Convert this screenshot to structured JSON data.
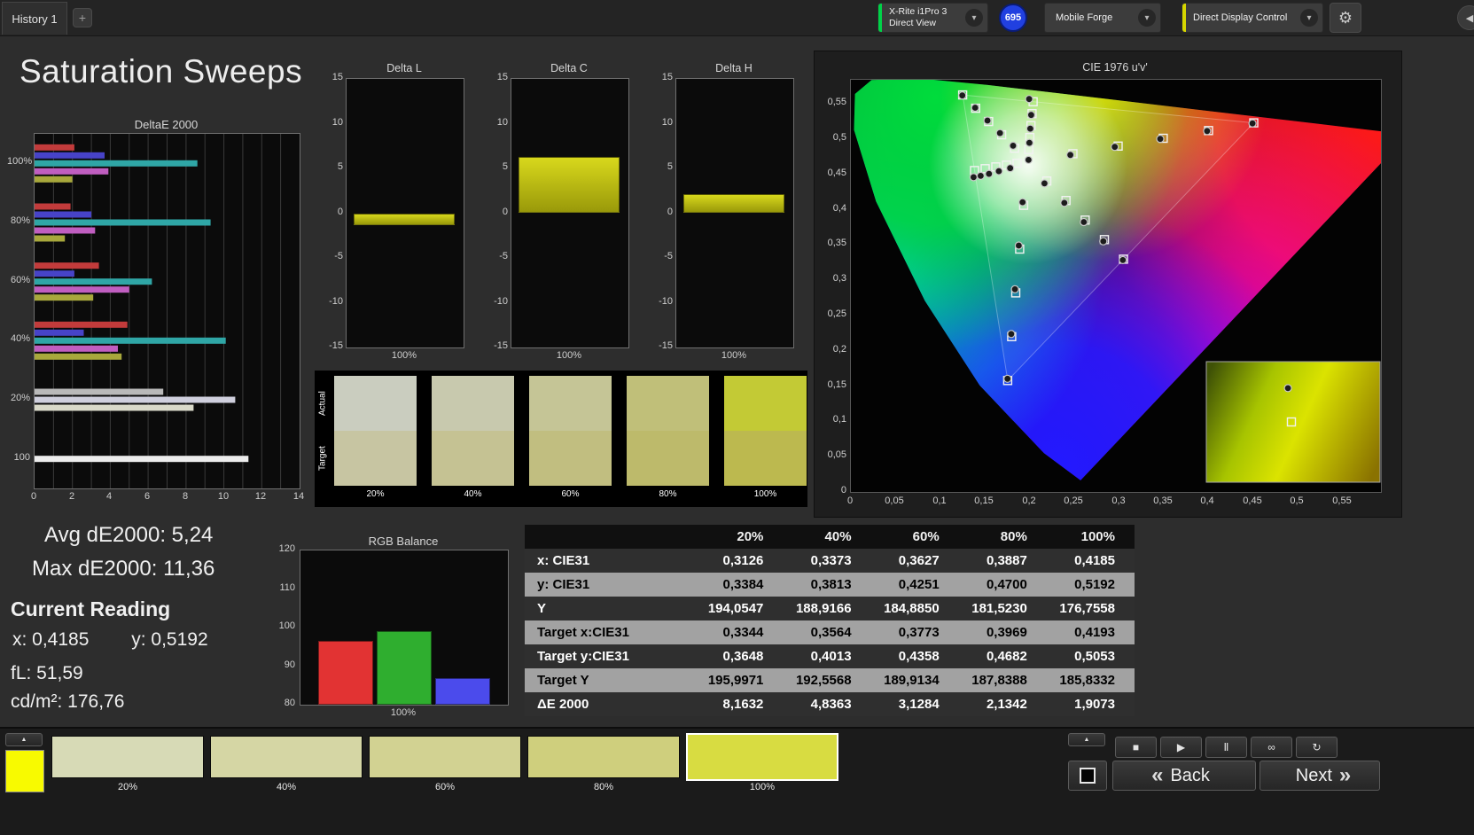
{
  "top_bar": {
    "history_tab": "History 1",
    "add_tab": "+",
    "meter": {
      "line1": "X-Rite i1Pro 3",
      "line2": "Direct View",
      "accent": "#00d248"
    },
    "badge": "695",
    "source": {
      "label": "Mobile Forge"
    },
    "display_control": {
      "label": "Direct Display Control",
      "accent": "#d6d600"
    }
  },
  "page": {
    "title": "Saturation Sweeps"
  },
  "stats": {
    "avg": "Avg dE2000: 5,24",
    "max": "Max dE2000: 11,36",
    "current_reading_label": "Current Reading",
    "x": "x: 0,4185",
    "y": "y: 0,5192",
    "fl": "fL: 51,59",
    "cdm2": "cd/m²: 176,76"
  },
  "swatch_panel": {
    "row_labels": [
      "Actual",
      "Target"
    ],
    "columns": [
      {
        "label": "20%",
        "actual": "#cacdbf",
        "target": "#c7c5a2"
      },
      {
        "label": "40%",
        "actual": "#c8c9ae",
        "target": "#c5c293"
      },
      {
        "label": "60%",
        "actual": "#c5c596",
        "target": "#c1be80"
      },
      {
        "label": "80%",
        "actual": "#c0bf79",
        "target": "#bdba6b"
      },
      {
        "label": "100%",
        "actual": "#c3ca35",
        "target": "#bcb94f"
      }
    ]
  },
  "chart_data": [
    {
      "id": "deltaE2000",
      "type": "bar",
      "orientation": "horizontal",
      "title": "DeltaE 2000",
      "xlim": [
        0,
        14
      ],
      "x_ticks": [
        0,
        2,
        4,
        6,
        8,
        10,
        12,
        14
      ],
      "grid_step": 1,
      "groups": [
        {
          "label": "100%",
          "bars": [
            {
              "color": "#c23b3b",
              "value": 2.1
            },
            {
              "color": "#4743c8",
              "value": 3.7
            },
            {
              "color": "#2fa6a6",
              "value": 8.6
            },
            {
              "color": "#c05ec0",
              "value": 3.9
            },
            {
              "color": "#a8a83c",
              "value": 2.0
            }
          ]
        },
        {
          "label": "80%",
          "bars": [
            {
              "color": "#c23b3b",
              "value": 1.9
            },
            {
              "color": "#4743c8",
              "value": 3.0
            },
            {
              "color": "#2fa6a6",
              "value": 9.3
            },
            {
              "color": "#c05ec0",
              "value": 3.2
            },
            {
              "color": "#a8a83c",
              "value": 1.6
            }
          ]
        },
        {
          "label": "60%",
          "bars": [
            {
              "color": "#c23b3b",
              "value": 3.4
            },
            {
              "color": "#4743c8",
              "value": 2.1
            },
            {
              "color": "#2fa6a6",
              "value": 6.2
            },
            {
              "color": "#c05ec0",
              "value": 5.0
            },
            {
              "color": "#a8a83c",
              "value": 3.1
            }
          ]
        },
        {
          "label": "40%",
          "bars": [
            {
              "color": "#c23b3b",
              "value": 4.9
            },
            {
              "color": "#4743c8",
              "value": 2.6
            },
            {
              "color": "#2fa6a6",
              "value": 10.1
            },
            {
              "color": "#c05ec0",
              "value": 4.4
            },
            {
              "color": "#a8a83c",
              "value": 4.6
            }
          ]
        },
        {
          "label": "20%",
          "bars": [
            {
              "color": "#b9b9b9",
              "value": 6.8
            },
            {
              "color": "#cfcfdd",
              "value": 10.6
            },
            {
              "color": "#d9d9c9",
              "value": 8.4
            }
          ]
        },
        {
          "label": "100",
          "bars": [
            {
              "color": "#ececec",
              "value": 11.3
            }
          ]
        }
      ]
    },
    {
      "id": "delta_l",
      "type": "bar",
      "title": "Delta L",
      "categories": [
        "100%"
      ],
      "values": [
        -1.3
      ],
      "ylim": [
        -15,
        15
      ],
      "y_ticks": [
        15,
        10,
        5,
        0,
        -5,
        -10,
        -15
      ],
      "bar_top": "#d8d81c",
      "bar_bottom": "#99990a"
    },
    {
      "id": "delta_c",
      "type": "bar",
      "title": "Delta C",
      "categories": [
        "100%"
      ],
      "values": [
        6.3
      ],
      "ylim": [
        -15,
        15
      ],
      "y_ticks": [
        15,
        10,
        5,
        0,
        -5,
        -10,
        -15
      ],
      "bar_top": "#d8d81c",
      "bar_bottom": "#99990a"
    },
    {
      "id": "delta_h",
      "type": "bar",
      "title": "Delta H",
      "categories": [
        "100%"
      ],
      "values": [
        2.1
      ],
      "ylim": [
        -15,
        15
      ],
      "y_ticks": [
        15,
        10,
        5,
        0,
        -5,
        -10,
        -15
      ],
      "bar_top": "#d8d81c",
      "bar_bottom": "#99990a"
    },
    {
      "id": "cie1976",
      "type": "scatter",
      "title": "CIE 1976 u'v'",
      "xlim": [
        0,
        0.593
      ],
      "ylim": [
        0,
        0.584
      ],
      "ticks": [
        0,
        0.05,
        0.1,
        0.15,
        0.2,
        0.25,
        0.3,
        0.35,
        0.4,
        0.45,
        0.5,
        0.55
      ],
      "spectral_locus": [
        [
          0.2569,
          0.0165
        ],
        [
          0.2161,
          0.0549
        ],
        [
          0.1441,
          0.151
        ],
        [
          0.0828,
          0.2708
        ],
        [
          0.0282,
          0.4117
        ],
        [
          0.0035,
          0.5131
        ],
        [
          0.0046,
          0.5639
        ],
        [
          0.0231,
          0.5837
        ],
        [
          0.0792,
          0.5856
        ],
        [
          0.1531,
          0.5766
        ],
        [
          0.2623,
          0.5604
        ],
        [
          0.4035,
          0.5393
        ],
        [
          0.5202,
          0.5219
        ],
        [
          0.6005,
          0.5099
        ],
        [
          0.6234,
          0.5065
        ]
      ],
      "srgb_triangle": [
        [
          0.4507,
          0.5229
        ],
        [
          0.125,
          0.5625
        ],
        [
          0.1754,
          0.1579
        ]
      ],
      "targets": [
        [
          0.2484,
          0.4792
        ],
        [
          0.299,
          0.4901
        ],
        [
          0.3495,
          0.5011
        ],
        [
          0.4001,
          0.512
        ],
        [
          0.4507,
          0.5229
        ],
        [
          0.1832,
          0.4871
        ],
        [
          0.1687,
          0.506
        ],
        [
          0.1541,
          0.5248
        ],
        [
          0.1396,
          0.5437
        ],
        [
          0.125,
          0.5625
        ],
        [
          0.1933,
          0.4062
        ],
        [
          0.1888,
          0.3441
        ],
        [
          0.1844,
          0.2821
        ],
        [
          0.1799,
          0.22
        ],
        [
          0.1754,
          0.1579
        ],
        [
          0.1859,
          0.4657
        ],
        [
          0.174,
          0.4631
        ],
        [
          0.1621,
          0.4606
        ],
        [
          0.1502,
          0.458
        ],
        [
          0.1383,
          0.4554
        ],
        [
          0.2192,
          0.4406
        ],
        [
          0.2407,
          0.4129
        ],
        [
          0.2621,
          0.3852
        ],
        [
          0.2836,
          0.3575
        ],
        [
          0.305,
          0.3298
        ],
        [
          0.199,
          0.4852
        ],
        [
          0.2002,
          0.5021
        ],
        [
          0.2015,
          0.5191
        ],
        [
          0.2027,
          0.536
        ],
        [
          0.2039,
          0.5529
        ]
      ],
      "measured": [
        [
          0.2455,
          0.4775
        ],
        [
          0.2952,
          0.4889
        ],
        [
          0.3461,
          0.5002
        ],
        [
          0.3985,
          0.5114
        ],
        [
          0.4493,
          0.5222
        ],
        [
          0.1815,
          0.4905
        ],
        [
          0.1668,
          0.5085
        ],
        [
          0.1528,
          0.5262
        ],
        [
          0.139,
          0.5445
        ],
        [
          0.1246,
          0.5618
        ],
        [
          0.1921,
          0.4105
        ],
        [
          0.1878,
          0.3492
        ],
        [
          0.1836,
          0.2872
        ],
        [
          0.1794,
          0.2238
        ],
        [
          0.1752,
          0.1604
        ],
        [
          0.1782,
          0.4588
        ],
        [
          0.1655,
          0.4545
        ],
        [
          0.1545,
          0.4508
        ],
        [
          0.1452,
          0.4478
        ],
        [
          0.1372,
          0.446
        ],
        [
          0.2166,
          0.4372
        ],
        [
          0.2388,
          0.4096
        ],
        [
          0.2606,
          0.3824
        ],
        [
          0.2824,
          0.3552
        ],
        [
          0.3042,
          0.3285
        ],
        [
          0.1987,
          0.4705
        ],
        [
          0.1997,
          0.4947
        ],
        [
          0.2007,
          0.5148
        ],
        [
          0.2017,
          0.5342
        ],
        [
          0.1994,
          0.5567
        ]
      ],
      "inset": {
        "circle": [
          0.47,
          0.22
        ],
        "square": [
          0.49,
          0.5
        ]
      }
    },
    {
      "id": "rgb_balance",
      "type": "bar",
      "title": "RGB Balance",
      "categories": [
        "Red",
        "Green",
        "Blue"
      ],
      "values": [
        96.5,
        99,
        87
      ],
      "colors": [
        "#e23333",
        "#2fae2f",
        "#4b4bec"
      ],
      "ylim": [
        80,
        120
      ],
      "y_ticks": [
        120,
        110,
        100,
        90,
        80
      ],
      "xlabel": "100%"
    },
    {
      "id": "measurements",
      "type": "table",
      "columns": [
        "",
        "20%",
        "40%",
        "60%",
        "80%",
        "100%"
      ],
      "rows": [
        {
          "label": "x: CIE31",
          "values": [
            "0,3126",
            "0,3373",
            "0,3627",
            "0,3887",
            "0,4185"
          ]
        },
        {
          "label": "y: CIE31",
          "values": [
            "0,3384",
            "0,3813",
            "0,4251",
            "0,4700",
            "0,5192"
          ]
        },
        {
          "label": "Y",
          "values": [
            "194,0547",
            "188,9166",
            "184,8850",
            "181,5230",
            "176,7558"
          ]
        },
        {
          "label": "Target x:CIE31",
          "values": [
            "0,3344",
            "0,3564",
            "0,3773",
            "0,3969",
            "0,4193"
          ]
        },
        {
          "label": "Target y:CIE31",
          "values": [
            "0,3648",
            "0,4013",
            "0,4358",
            "0,4682",
            "0,5053"
          ]
        },
        {
          "label": "Target Y",
          "values": [
            "195,9971",
            "192,5568",
            "189,9134",
            "187,8388",
            "185,8332"
          ]
        },
        {
          "label": "ΔE 2000",
          "values": [
            "8,1632",
            "4,8363",
            "3,1284",
            "2,1342",
            "1,9073"
          ]
        }
      ]
    }
  ],
  "bottom_bar": {
    "corner_color": "#f8fa00",
    "swatches": [
      {
        "label": "20%",
        "color": "#d7dab6",
        "selected": false
      },
      {
        "label": "40%",
        "color": "#d5d6a4",
        "selected": false
      },
      {
        "label": "60%",
        "color": "#d2d292",
        "selected": false
      },
      {
        "label": "80%",
        "color": "#cfcf7d",
        "selected": false
      },
      {
        "label": "100%",
        "color": "#d8dc41",
        "selected": true
      }
    ],
    "transport": [
      {
        "name": "stop-icon",
        "glyph": "■"
      },
      {
        "name": "play-icon",
        "glyph": "▶"
      },
      {
        "name": "pause-icon",
        "glyph": "Ⅱ"
      },
      {
        "name": "continuous-icon",
        "glyph": "∞"
      },
      {
        "name": "loop-icon",
        "glyph": "↻"
      }
    ],
    "back_icon": "«",
    "back_label": "Back",
    "next_label": "Next",
    "next_icon": "»"
  }
}
